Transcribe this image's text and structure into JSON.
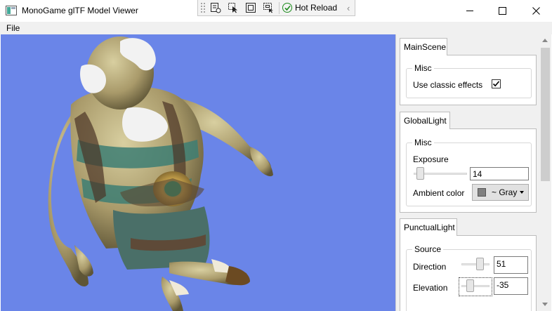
{
  "window": {
    "title": "MonoGame glTF Model Viewer",
    "minimize_label": "minimize",
    "maximize_label": "maximize",
    "close_label": "close"
  },
  "debug_toolbar": {
    "hot_reload_label": "Hot Reload"
  },
  "menu": {
    "items": [
      {
        "label": "File"
      }
    ]
  },
  "viewport": {
    "background_color": "#6a85e8"
  },
  "sections": {
    "main_scene": {
      "tab": "MainScene",
      "group": "Misc",
      "use_classic_effects_label": "Use classic effects",
      "use_classic_effects_checked": true
    },
    "global_light": {
      "tab": "GlobalLight",
      "group": "Misc",
      "exposure_label": "Exposure",
      "exposure_value": "14",
      "ambient_color_label": "Ambient color",
      "ambient_color_value": "~ Gray",
      "ambient_color_swatch": "#808080"
    },
    "punctual_light": {
      "tab": "PunctualLight",
      "group": "Source",
      "direction_label": "Direction",
      "direction_value": "51",
      "elevation_label": "Elevation",
      "elevation_value": "-35"
    }
  }
}
